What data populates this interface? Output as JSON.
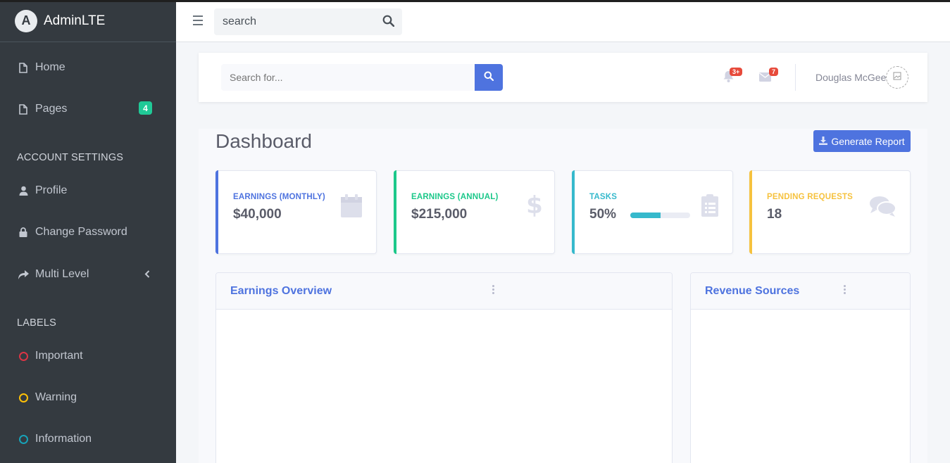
{
  "brand": {
    "name_prefix": "Admin",
    "name_suffix": "LTE",
    "logo_letter": "A"
  },
  "sidebar": {
    "items": [
      {
        "label": "Home"
      },
      {
        "label": "Pages",
        "badge": "4"
      }
    ],
    "account_header": "ACCOUNT SETTINGS",
    "account_items": [
      {
        "label": "Profile"
      },
      {
        "label": "Change Password"
      },
      {
        "label": "Multi Level"
      }
    ],
    "labels_header": "LABELS",
    "label_items": [
      {
        "label": "Important",
        "color": "#dc3545"
      },
      {
        "label": "Warning",
        "color": "#ffc107"
      },
      {
        "label": "Information",
        "color": "#17a2b8"
      }
    ]
  },
  "topnav": {
    "search_value": "search"
  },
  "inner_header": {
    "search_placeholder": "Search for...",
    "alerts_count": "3+",
    "messages_count": "7",
    "user_name": "Douglas McGee"
  },
  "dashboard": {
    "title": "Dashboard",
    "generate_button": "Generate Report",
    "stats": [
      {
        "label": "EARNINGS (MONTHLY)",
        "value": "$40,000",
        "color": "#4e73df",
        "icon": "calendar-icon"
      },
      {
        "label": "EARNINGS (ANNUAL)",
        "value": "$215,000",
        "color": "#1cc88a",
        "icon": "dollar-icon"
      },
      {
        "label": "TASKS",
        "value": "50%",
        "progress": 0.5,
        "color": "#36b9cc",
        "icon": "clipboard-icon"
      },
      {
        "label": "PENDING REQUESTS",
        "value": "18",
        "color": "#f6c23e",
        "icon": "comments-icon"
      }
    ],
    "panels": [
      {
        "title": "Earnings Overview"
      },
      {
        "title": "Revenue Sources"
      }
    ]
  }
}
